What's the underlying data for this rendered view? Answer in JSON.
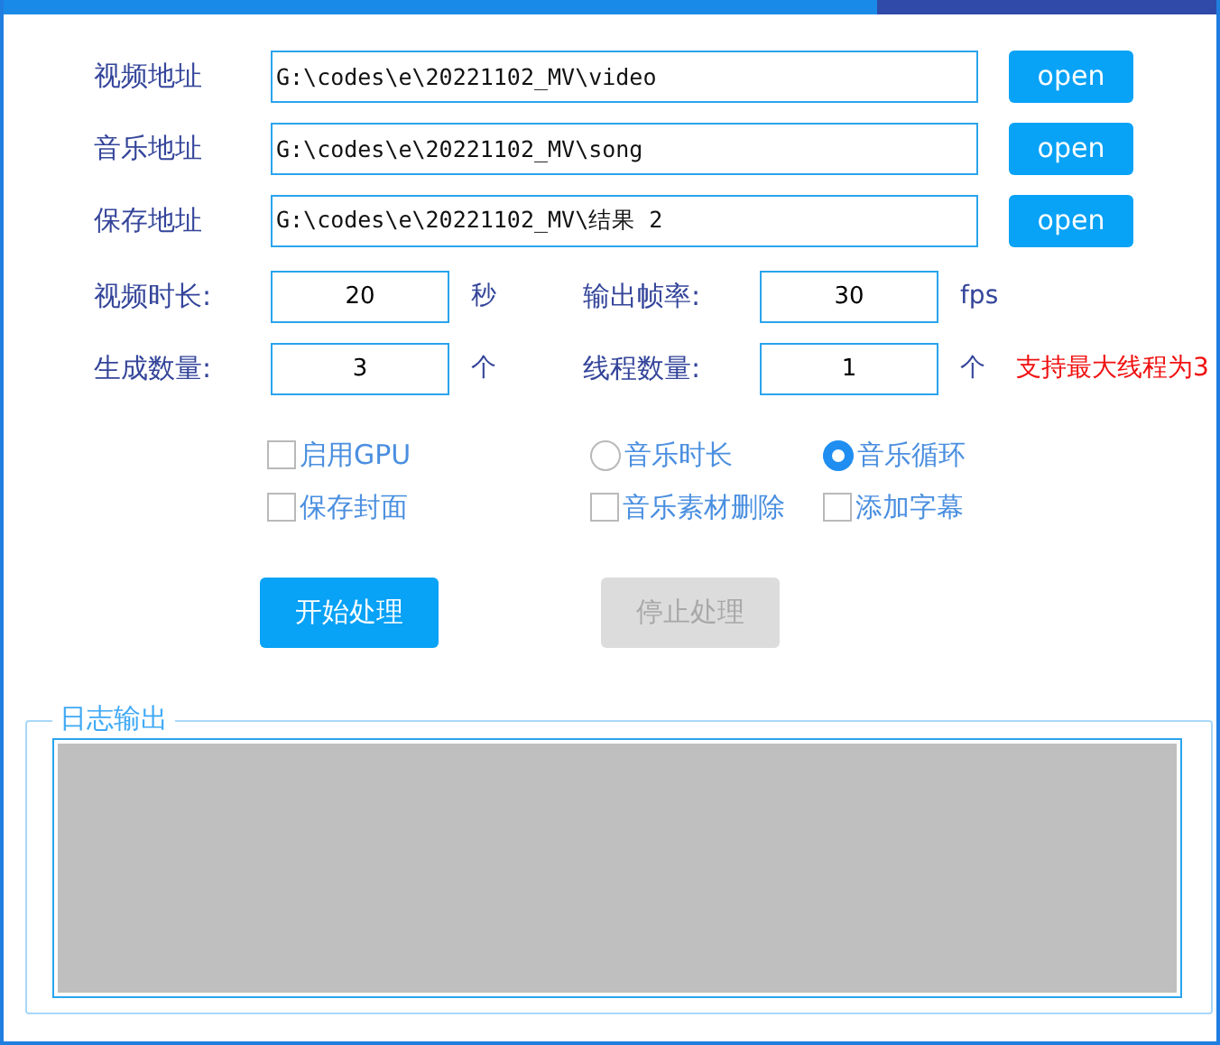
{
  "paths": [
    {
      "label": "视频地址",
      "value": "G:\\codes\\e\\20221102_MV\\video",
      "button": "open"
    },
    {
      "label": "音乐地址",
      "value": "G:\\codes\\e\\20221102_MV\\song",
      "button": "open"
    },
    {
      "label": "保存地址",
      "value": "G:\\codes\\e\\20221102_MV\\结果 2",
      "button": "open"
    }
  ],
  "params": [
    {
      "fields": [
        {
          "label": "视频时长:",
          "value": "20",
          "unit": "秒"
        },
        {
          "label": "输出帧率:",
          "value": "30",
          "unit": "fps"
        }
      ]
    },
    {
      "fields": [
        {
          "label": "生成数量:",
          "value": "3",
          "unit": "个"
        },
        {
          "label": "线程数量:",
          "value": "1",
          "unit": "个"
        }
      ],
      "note": "支持最大线程为3"
    }
  ],
  "options": [
    {
      "kind": "checkbox",
      "label": "启用GPU",
      "checked": false
    },
    {
      "kind": "radio",
      "label": "音乐时长",
      "selected": false
    },
    {
      "kind": "radio",
      "label": "音乐循环",
      "selected": true
    },
    {
      "kind": "checkbox",
      "label": "保存封面",
      "checked": false
    },
    {
      "kind": "checkbox",
      "label": "音乐素材删除",
      "checked": false
    },
    {
      "kind": "checkbox",
      "label": "添加字幕",
      "checked": false
    }
  ],
  "actions": [
    {
      "label": "开始处理",
      "disabled": false
    },
    {
      "label": "停止处理",
      "disabled": true
    }
  ],
  "log": {
    "title": "日志输出"
  }
}
